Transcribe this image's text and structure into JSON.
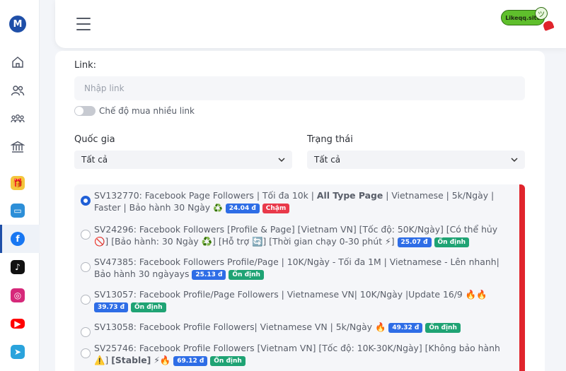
{
  "sidebar": {
    "logo_text": "M",
    "icons": [
      "home-icon",
      "users-icon",
      "group-icon",
      "bank-icon",
      "gift-icon",
      "monitor-icon",
      "facebook-icon",
      "tiktok-icon",
      "instagram-icon",
      "youtube-icon",
      "telegram-icon"
    ]
  },
  "header": {
    "site_badge_text": "Likeqq.site",
    "smile": "ツ"
  },
  "form": {
    "link_label": "Link:",
    "link_placeholder": "Nhập link",
    "multi_link_label": "Chế độ mua nhiều link",
    "country_label": "Quốc gia",
    "country_value": "Tất cả",
    "status_label": "Trạng thái",
    "status_value": "Tất cả"
  },
  "services": [
    {
      "selected": true,
      "pre": "SV132770: Facebook Page Followers | Tối đa 10k | ",
      "bold": "All Type Page",
      "post": " | Vietnamese | 5k/Ngày | Faster | Bảo hành 30 Ngày ",
      "emoji": "♻️",
      "price": "24.04 đ",
      "status": "Chậm",
      "status_type": "slow"
    },
    {
      "selected": false,
      "pre": "SV24296: Facebook Followers [Profile & Page] [Vietnam VN] [Tốc độ: 50K/Ngày] [Có thể hủy 🚫] [Bảo hành: 30 Ngày ♻️] [Hỗ trợ 🔄] [Thời gian chạy 0-30 phút ⚡] ",
      "bold": "",
      "post": "",
      "emoji": "",
      "price": "25.07 đ",
      "status": "Ổn định",
      "status_type": "stable"
    },
    {
      "selected": false,
      "pre": "SV47385: Facebook Followers Profile/Page | 10K/Ngày - Tối đa 1M | Vietnamese - Lên nhanh| Bảo hành 30 ngàyays ",
      "bold": "",
      "post": "",
      "emoji": "",
      "price": "25.13 đ",
      "status": "Ổn định",
      "status_type": "stable"
    },
    {
      "selected": false,
      "pre": "SV13057: Facebook Profile/Page Followers | Vietnamese VN| 10K/Ngày |Update 16/9 🔥🔥 ",
      "bold": "",
      "post": "",
      "emoji": "",
      "price": "39.73 đ",
      "status": "Ổn định",
      "status_type": "stable"
    },
    {
      "selected": false,
      "pre": "SV13058: Facebook Profile Followers| Vietnamese VN | 5k/Ngày 🔥 ",
      "bold": "",
      "post": "",
      "emoji": "",
      "price": "49.32 đ",
      "status": "Ổn định",
      "status_type": "stable"
    },
    {
      "selected": false,
      "pre": "SV25746: Facebook Profile Followers [Vietnam VN] [Tốc độ: 10K-30K/Ngày] [Không bảo hành ⚠️] ",
      "bold": "[Stable]",
      "post": " ⚡🔥 ",
      "emoji": "",
      "price": "69.12 đ",
      "status": "Ổn định",
      "status_type": "stable"
    }
  ],
  "colors": {
    "accent": "#1f5fd6",
    "price_bg": "#2e6de6",
    "slow_bg": "#e9394a",
    "stable_bg": "#1fa374",
    "scroll": "#e0242c"
  }
}
